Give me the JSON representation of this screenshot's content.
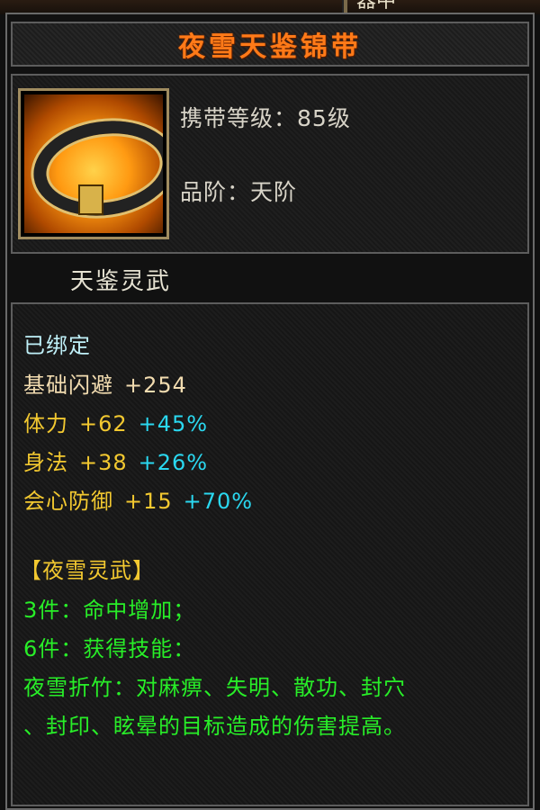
{
  "top_fragment": "器中",
  "item": {
    "name": "夜雪天鉴锦带",
    "carry_level_label": "携带等级：",
    "carry_level_value": "85级",
    "grade_label": "品阶：",
    "grade_value": "天阶",
    "series_name": "天鉴灵武",
    "icon": "belt-item-icon"
  },
  "attributes": {
    "bound_status": "已绑定",
    "stats": [
      {
        "name": "基础闪避",
        "value": "+254",
        "bonus": ""
      },
      {
        "name": "体力",
        "value": "+62",
        "bonus": "+45%"
      },
      {
        "name": "身法",
        "value": "+38",
        "bonus": "+26%"
      },
      {
        "name": "会心防御",
        "value": "+15",
        "bonus": "+70%"
      }
    ]
  },
  "set": {
    "title": "【夜雪灵武】",
    "bonus3": "3件：命中增加；",
    "bonus6": "6件：获得技能：",
    "skill_line1": "夜雪折竹：对麻痹、失明、散功、封穴",
    "skill_line2": "、封印、眩晕的目标造成的伤害提高。"
  },
  "colors": {
    "title": "#ff7a18",
    "bound": "#bff0f8",
    "base_stat": "#f2dcb0",
    "stat": "#f2c830",
    "bonus": "#2ad8f0",
    "set_text": "#28ee28"
  }
}
